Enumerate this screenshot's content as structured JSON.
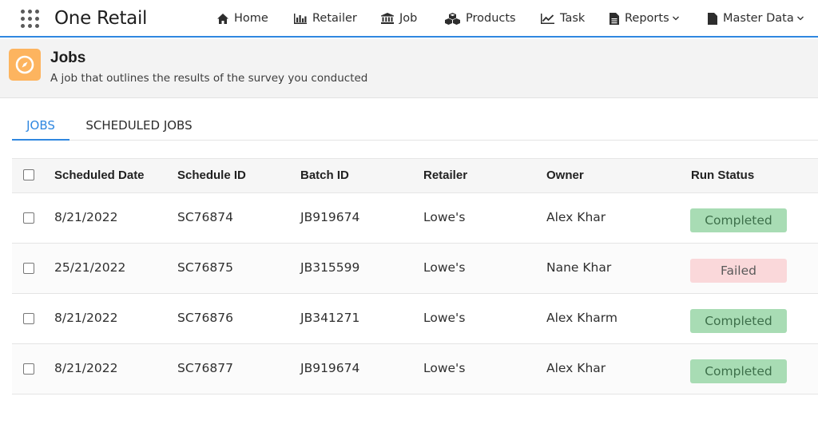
{
  "app": {
    "name": "One Retail"
  },
  "nav": [
    {
      "label": "Home",
      "icon": "home-icon"
    },
    {
      "label": "Retailer",
      "icon": "bar-chart-icon"
    },
    {
      "label": "Job",
      "icon": "bank-icon"
    },
    {
      "label": "Products",
      "icon": "cubes-icon"
    },
    {
      "label": "Task",
      "icon": "line-chart-icon"
    },
    {
      "label": "Reports",
      "icon": "document-icon",
      "dropdown": true
    },
    {
      "label": "Master Data",
      "icon": "file-icon",
      "dropdown": true
    }
  ],
  "page": {
    "title": "Jobs",
    "subtitle": "A job that outlines the results of the survey you conducted",
    "icon": "compass-icon",
    "icon_color": "#fdb45f"
  },
  "tabs": [
    {
      "label": "JOBS",
      "active": true
    },
    {
      "label": "SCHEDULED JOBS",
      "active": false
    }
  ],
  "table": {
    "columns": [
      "Scheduled Date",
      "Schedule ID",
      "Batch ID",
      "Retailer",
      "Owner",
      "Run Status"
    ],
    "rows": [
      {
        "date": "8/21/2022",
        "schedule_id": "SC76874",
        "batch_id": "JB919674",
        "retailer": "Lowe's",
        "owner": "Alex Khar",
        "status": "Completed"
      },
      {
        "date": "25/21/2022",
        "schedule_id": "SC76875",
        "batch_id": "JB315599",
        "retailer": "Lowe's",
        "owner": "Nane Khar",
        "status": "Failed"
      },
      {
        "date": "8/21/2022",
        "schedule_id": "SC76876",
        "batch_id": "JB341271",
        "retailer": "Lowe's",
        "owner": "Alex Kharm",
        "status": "Completed"
      },
      {
        "date": "8/21/2022",
        "schedule_id": "SC76877",
        "batch_id": "JB919674",
        "retailer": "Lowe's",
        "owner": "Alex Khar",
        "status": "Completed"
      }
    ]
  },
  "colors": {
    "accent": "#2f87e0",
    "completed_bg": "#a8dcb4",
    "failed_bg": "#fad8da"
  }
}
